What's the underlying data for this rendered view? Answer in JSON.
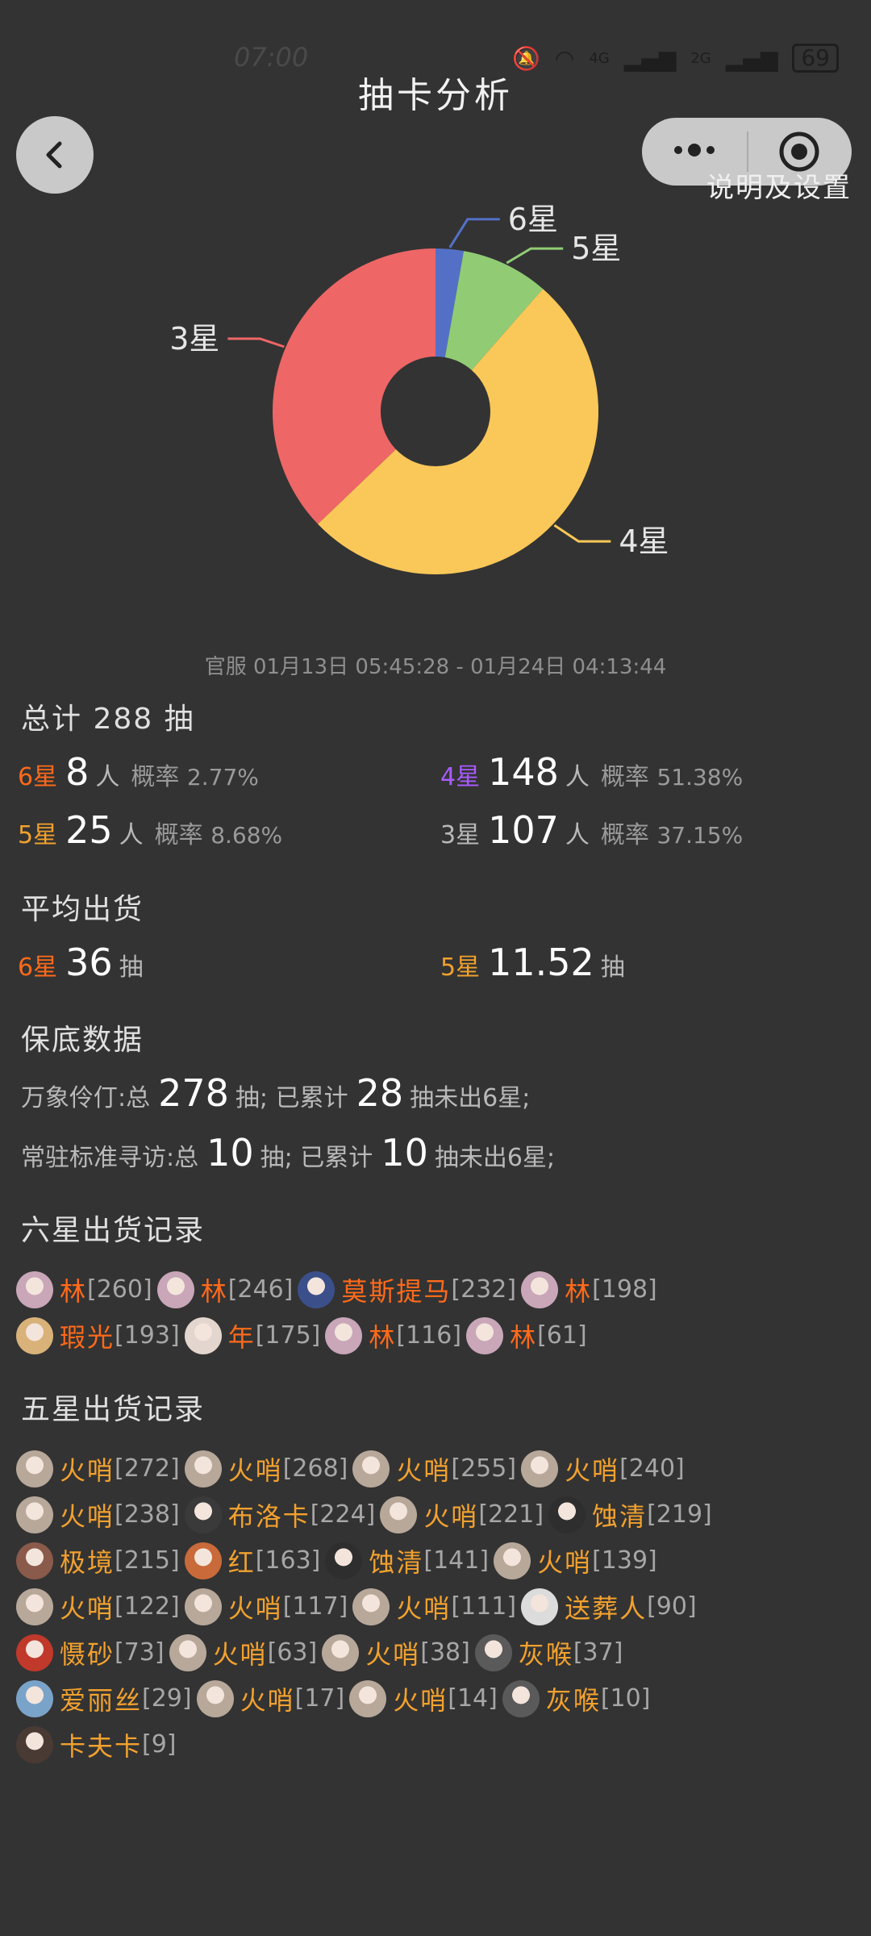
{
  "status_bar": {
    "time": "07:00",
    "network": [
      "4G",
      "2G"
    ],
    "battery": "69"
  },
  "header": {
    "title": "抽卡分析",
    "settings_label": "说明及设置"
  },
  "chart_data": {
    "type": "pie",
    "donut": true,
    "categories": [
      "6星",
      "5星",
      "4星",
      "3星"
    ],
    "values": [
      8,
      25,
      148,
      107
    ],
    "colors": [
      "#5470c6",
      "#91cc75",
      "#fac858",
      "#ee6666"
    ]
  },
  "date_range": "官服 01月13日 05:45:28 - 01月24日 04:13:44",
  "total": {
    "label": "总计 288 抽"
  },
  "stats": [
    {
      "star": "6星",
      "count": "8",
      "unit": "人",
      "prob_label": "概率",
      "prob": "2.77%",
      "cls": "c6"
    },
    {
      "star": "4星",
      "count": "148",
      "unit": "人",
      "prob_label": "概率",
      "prob": "51.38%",
      "cls": "c4"
    },
    {
      "star": "5星",
      "count": "25",
      "unit": "人",
      "prob_label": "概率",
      "prob": "8.68%",
      "cls": "c5"
    },
    {
      "star": "3星",
      "count": "107",
      "unit": "人",
      "prob_label": "概率",
      "prob": "37.15%",
      "cls": "c3"
    }
  ],
  "avg": {
    "title": "平均出货",
    "six": {
      "star": "6星",
      "value": "36",
      "unit": "抽"
    },
    "five": {
      "star": "5星",
      "value": "11.52",
      "unit": "抽"
    }
  },
  "pity": {
    "title": "保底数据",
    "lines": [
      {
        "prefix": "万象伶仃:总",
        "total": "278",
        "mid": "抽; 已累计",
        "acc": "28",
        "suffix": "抽未出6星;"
      },
      {
        "prefix": "常驻标准寻访:总",
        "total": "10",
        "mid": "抽; 已累计",
        "acc": "10",
        "suffix": "抽未出6星;"
      }
    ]
  },
  "six_records": {
    "title": "六星出货记录",
    "lines": [
      [
        {
          "name": "林",
          "count": "[260]",
          "color": "#c9a6b8"
        },
        {
          "name": "林",
          "count": "[246]",
          "color": "#c9a6b8"
        },
        {
          "name": "莫斯提马",
          "count": "[232]",
          "color": "#3b4f8a"
        },
        {
          "name": "林",
          "count": "[198]",
          "color": "#c9a6b8"
        }
      ],
      [
        {
          "name": "瑕光",
          "count": "[193]",
          "color": "#d9b27a"
        },
        {
          "name": "年",
          "count": "[175]",
          "color": "#e3d6cf"
        },
        {
          "name": "林",
          "count": "[116]",
          "color": "#c9a6b8"
        },
        {
          "name": "林",
          "count": "[61]",
          "color": "#c9a6b8"
        }
      ]
    ]
  },
  "five_records": {
    "title": "五星出货记录",
    "lines": [
      [
        {
          "name": "火哨",
          "count": "[272]",
          "color": "#b7a89a"
        },
        {
          "name": "火哨",
          "count": "[268]",
          "color": "#b7a89a"
        },
        {
          "name": "火哨",
          "count": "[255]",
          "color": "#b7a89a"
        },
        {
          "name": "火哨",
          "count": "[240]",
          "color": "#b7a89a"
        }
      ],
      [
        {
          "name": "火哨",
          "count": "[238]",
          "color": "#b7a89a"
        },
        {
          "name": "布洛卡",
          "count": "[224]",
          "color": "#3a3a3a"
        },
        {
          "name": "火哨",
          "count": "[221]",
          "color": "#b7a89a"
        },
        {
          "name": "蚀清",
          "count": "[219]",
          "color": "#2e2e2e"
        }
      ],
      [
        {
          "name": "极境",
          "count": "[215]",
          "color": "#8a5a4a"
        },
        {
          "name": "红",
          "count": "[163]",
          "color": "#c96a3a"
        },
        {
          "name": "蚀清",
          "count": "[141]",
          "color": "#2e2e2e"
        },
        {
          "name": "火哨",
          "count": "[139]",
          "color": "#b7a89a"
        }
      ],
      [
        {
          "name": "火哨",
          "count": "[122]",
          "color": "#b7a89a"
        },
        {
          "name": "火哨",
          "count": "[117]",
          "color": "#b7a89a"
        },
        {
          "name": "火哨",
          "count": "[111]",
          "color": "#b7a89a"
        },
        {
          "name": "送葬人",
          "count": "[90]",
          "color": "#dcdcdc"
        }
      ],
      [
        {
          "name": "慑砂",
          "count": "[73]",
          "color": "#c0392b"
        },
        {
          "name": "火哨",
          "count": "[63]",
          "color": "#b7a89a"
        },
        {
          "name": "火哨",
          "count": "[38]",
          "color": "#b7a89a"
        },
        {
          "name": "灰喉",
          "count": "[37]",
          "color": "#5a5a5a"
        }
      ],
      [
        {
          "name": "爱丽丝",
          "count": "[29]",
          "color": "#7aa3c9"
        },
        {
          "name": "火哨",
          "count": "[17]",
          "color": "#b7a89a"
        },
        {
          "name": "火哨",
          "count": "[14]",
          "color": "#b7a89a"
        },
        {
          "name": "灰喉",
          "count": "[10]",
          "color": "#5a5a5a"
        }
      ],
      [
        {
          "name": "卡夫卡",
          "count": "[9]",
          "color": "#4a3a34"
        }
      ]
    ]
  }
}
